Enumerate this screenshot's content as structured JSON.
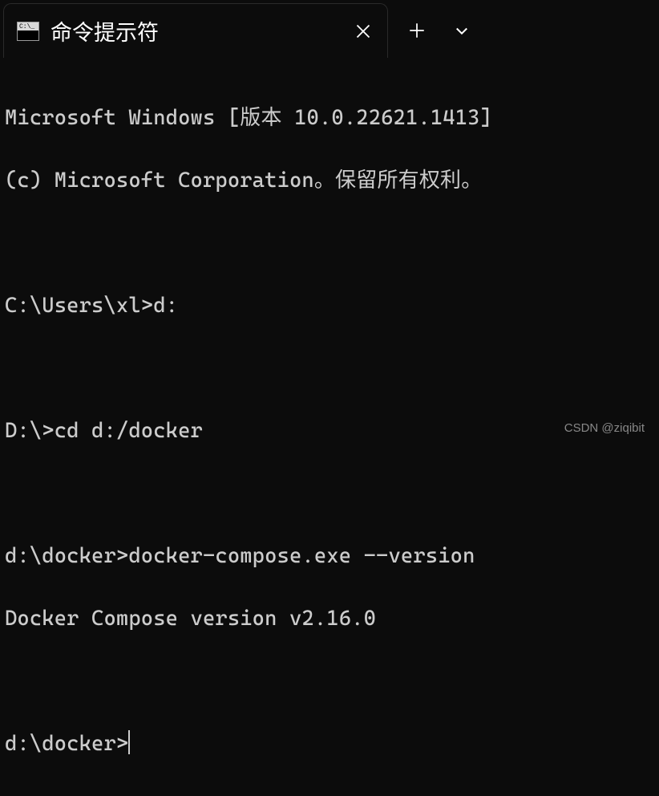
{
  "tab": {
    "title": "命令提示符"
  },
  "terminal": {
    "line1": "Microsoft Windows [版本 10.0.22621.1413]",
    "line2": "(c) Microsoft Corporation。保留所有权利。",
    "line3": "",
    "line4": "C:\\Users\\xl>d:",
    "line5": "",
    "line6": "D:\\>cd d:/docker",
    "line7": "",
    "line8": "d:\\docker>docker-compose.exe --version",
    "line9": "Docker Compose version v2.16.0",
    "line10": "",
    "line11": "d:\\docker>"
  },
  "watermark": "CSDN @ziqibit"
}
